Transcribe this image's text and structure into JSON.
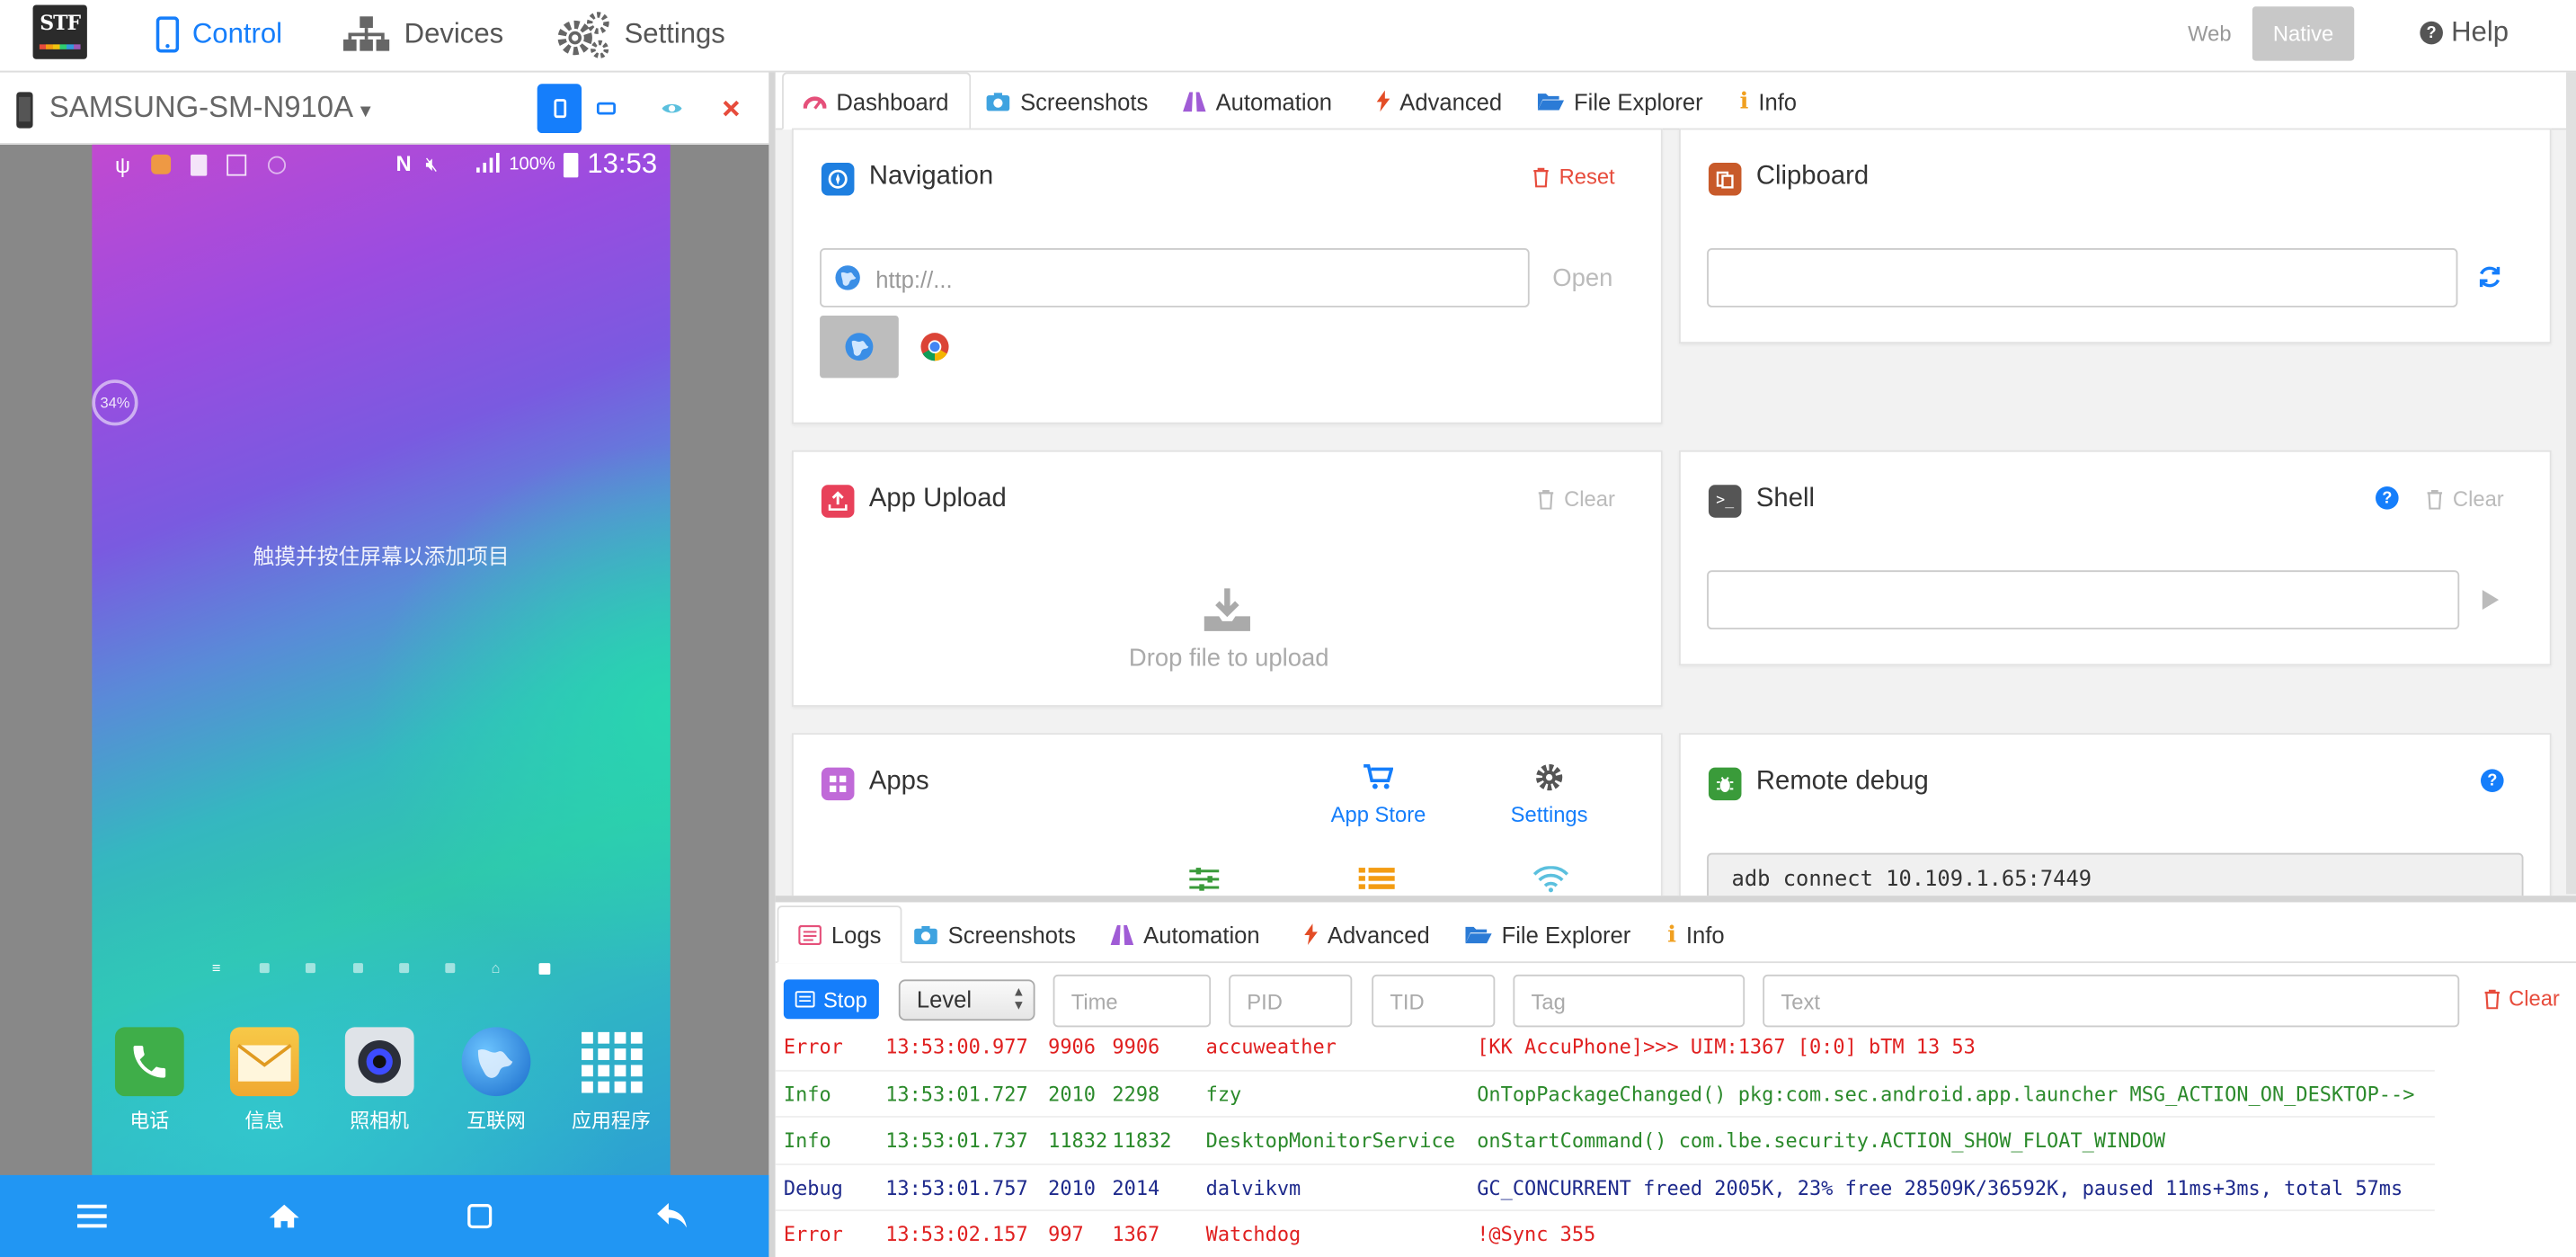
{
  "app": {
    "logo_text": "STF"
  },
  "topnav": {
    "items": [
      {
        "label": "Control",
        "icon": "mobile-icon",
        "active": true
      },
      {
        "label": "Devices",
        "icon": "sitemap-icon",
        "active": false
      },
      {
        "label": "Settings",
        "icon": "gears-icon",
        "active": false
      }
    ],
    "mode_web": "Web",
    "mode_native": "Native",
    "help": "Help"
  },
  "device": {
    "name": "SAMSUNG-SM-N910A",
    "status_time": "13:53",
    "battery": "100%",
    "progress_label": "34%",
    "home_hint": "触摸并按住屏幕以添加项目",
    "page_dots": 8,
    "dock": [
      {
        "label": "电话",
        "icon": "phone-app-icon"
      },
      {
        "label": "信息",
        "icon": "messages-app-icon"
      },
      {
        "label": "照相机",
        "icon": "camera-app-icon"
      },
      {
        "label": "互联网",
        "icon": "internet-app-icon"
      },
      {
        "label": "应用程序",
        "icon": "apps-grid-icon"
      }
    ]
  },
  "top_tabs": [
    "Dashboard",
    "Screenshots",
    "Automation",
    "Advanced",
    "File Explorer",
    "Info"
  ],
  "dashboard": {
    "navigation": {
      "title": "Navigation",
      "reset": "Reset",
      "url_placeholder": "http://...",
      "open": "Open"
    },
    "clipboard": {
      "title": "Clipboard"
    },
    "app_upload": {
      "title": "App Upload",
      "clear": "Clear",
      "drop": "Drop file to upload"
    },
    "shell": {
      "title": "Shell",
      "clear": "Clear"
    },
    "apps": {
      "title": "Apps",
      "app_store": "App Store",
      "settings": "Settings"
    },
    "remote_debug": {
      "title": "Remote debug",
      "command": "adb connect 10.109.1.65:7449"
    }
  },
  "bottom_tabs": [
    "Logs",
    "Screenshots",
    "Automation",
    "Advanced",
    "File Explorer",
    "Info"
  ],
  "logs": {
    "stop": "Stop",
    "level": "Level",
    "filters": {
      "time": "Time",
      "pid": "PID",
      "tid": "TID",
      "tag": "Tag",
      "text": "Text"
    },
    "clear": "Clear",
    "rows": [
      {
        "level": "Error",
        "time": "13:53:00.977",
        "pid": "9906",
        "tid": "9906",
        "tag": "accuweather",
        "text": "[KK AccuPhone]>>> UIM:1367 [0:0] bTM 13 53"
      },
      {
        "level": "Info",
        "time": "13:53:01.727",
        "pid": "2010",
        "tid": "2298",
        "tag": "fzy",
        "text": "OnTopPackageChanged() pkg:com.sec.android.app.launcher  MSG_ACTION_ON_DESKTOP-->"
      },
      {
        "level": "Info",
        "time": "13:53:01.737",
        "pid": "11832",
        "tid": "11832",
        "tag": "DesktopMonitorService",
        "text": "onStartCommand() com.lbe.security.ACTION_SHOW_FLOAT_WINDOW"
      },
      {
        "level": "Debug",
        "time": "13:53:01.757",
        "pid": "2010",
        "tid": "2014",
        "tag": "dalvikvm",
        "text": "GC_CONCURRENT freed 2005K, 23% free 28509K/36592K, paused 11ms+3ms, total 57ms"
      },
      {
        "level": "Error",
        "time": "13:53:02.157",
        "pid": "997",
        "tid": "1367",
        "tag": "Watchdog",
        "text": "!@Sync 355"
      }
    ]
  },
  "colors": {
    "accent": "#157efb",
    "danger": "#e74c3c",
    "navbar": "#2196f3"
  }
}
